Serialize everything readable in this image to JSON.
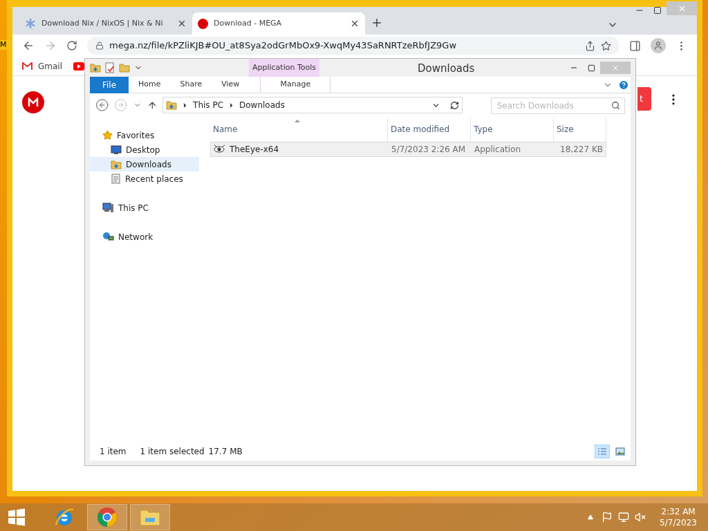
{
  "desktop": {
    "edge_text": "M"
  },
  "browser": {
    "tabs": [
      {
        "title": "Download Nix / NixOS | Nix & Ni",
        "selected": false
      },
      {
        "title": "Download - MEGA",
        "selected": true
      }
    ],
    "url": "mega.nz/file/kPZliKJB#OU_at8Sya2odGrMbOx9-XwqMy43SaRNRTzeRbfJZ9Gw",
    "bookmarks": [
      {
        "label": "Gmail",
        "kind": "gmail"
      },
      {
        "kind": "youtube"
      }
    ],
    "page": {
      "button_fragment": "t"
    }
  },
  "explorer": {
    "title": "Downloads",
    "contextual_tab": "Application Tools",
    "ribbon_tabs": [
      {
        "label": "File",
        "kind": "file",
        "selected": false
      },
      {
        "label": "Home",
        "kind": "tab",
        "selected": false
      },
      {
        "label": "Share",
        "kind": "tab",
        "selected": false
      },
      {
        "label": "View",
        "kind": "tab",
        "selected": false
      },
      {
        "label": "Manage",
        "kind": "contextual",
        "selected": false
      }
    ],
    "breadcrumb": [
      "This PC",
      "Downloads"
    ],
    "search_placeholder": "Search Downloads",
    "nav": [
      {
        "label": "Favorites",
        "kind": "favorites",
        "selected": false,
        "children": [
          {
            "label": "Desktop",
            "kind": "desktop",
            "selected": false
          },
          {
            "label": "Downloads",
            "kind": "downloads",
            "selected": true
          },
          {
            "label": "Recent places",
            "kind": "recent",
            "selected": false
          }
        ]
      },
      {
        "label": "This PC",
        "kind": "pc",
        "selected": false
      },
      {
        "label": "Network",
        "kind": "network",
        "selected": false
      }
    ],
    "columns": [
      "Name",
      "Date modified",
      "Type",
      "Size"
    ],
    "rows": [
      {
        "name": "TheEye-x64",
        "date": "5/7/2023 2:26 AM",
        "type": "Application",
        "size": "18,227 KB",
        "selected": true
      }
    ],
    "status": {
      "count": "1 item",
      "selection": "1 item selected",
      "size": "17.7 MB"
    },
    "view_buttons": [
      {
        "kind": "details",
        "selected": true
      },
      {
        "kind": "icons",
        "selected": false
      }
    ]
  },
  "taskbar": {
    "time": "2:32 AM",
    "date": "5/7/2023"
  }
}
